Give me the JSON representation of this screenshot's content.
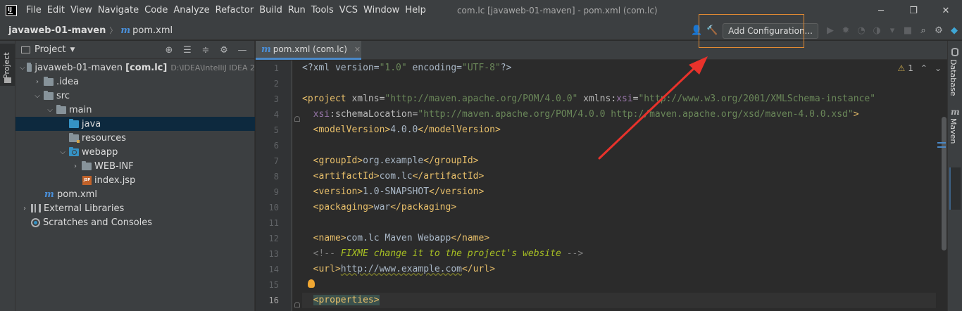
{
  "menu": {
    "items": [
      "File",
      "Edit",
      "View",
      "Navigate",
      "Code",
      "Analyze",
      "Refactor",
      "Build",
      "Run",
      "Tools",
      "VCS",
      "Window",
      "Help"
    ],
    "window_title": "com.lc [javaweb-01-maven] - pom.xml (com.lc)"
  },
  "window_controls": {
    "minimize": "─",
    "restore": "❐",
    "close": "✕"
  },
  "navbar": {
    "project": "javaweb-01-maven",
    "file": "pom.xml",
    "add_configuration": "Add Configuration..."
  },
  "project_panel": {
    "title": "Project",
    "tree": {
      "root_name": "javaweb-01-maven",
      "root_module": "[com.lc]",
      "root_path": "D:\\IDEA\\IntelliJ IDEA 2",
      "idea": ".idea",
      "src": "src",
      "main": "main",
      "java": "java",
      "resources": "resources",
      "webapp": "webapp",
      "webinf": "WEB-INF",
      "indexjsp": "index.jsp",
      "pom": "pom.xml",
      "external_libraries": "External Libraries",
      "scratches": "Scratches and Consoles"
    }
  },
  "left_stripe": {
    "project_tab": "Project"
  },
  "right_stripe": {
    "database": "Database",
    "maven": "Maven"
  },
  "editor": {
    "tab_label": "pom.xml (com.lc)",
    "warning_count": "1",
    "line_numbers": [
      "1",
      "2",
      "3",
      "4",
      "5",
      "6",
      "7",
      "8",
      "9",
      "10",
      "11",
      "12",
      "13",
      "14",
      "15",
      "16"
    ],
    "current_line": "16",
    "code": {
      "l1_a": "<?xml version=",
      "l1_b": "\"1.0\"",
      "l1_c": " encoding=",
      "l1_d": "\"UTF-8\"",
      "l1_e": "?>",
      "l3_tag": "<project",
      "l3_attr1": " xmlns=",
      "l3_val1": "\"http://maven.apache.org/POM/4.0.0\"",
      "l3_attr2a": " xmlns:",
      "l3_attr2b": "xsi",
      "l3_attr2c": "=",
      "l3_val2": "\"http://www.w3.org/2001/XMLSchema-instance\"",
      "l4_ns": "xsi",
      "l4_attr": ":schemaLocation=",
      "l4_val": "\"http://maven.apache.org/POM/4.0.0 http://maven.apache.org/xsd/maven-4.0.0.xsd\"",
      "l4_end": ">",
      "l5_open": "<modelVersion>",
      "l5_text": "4.0.0",
      "l5_close": "</modelVersion>",
      "l7_open": "<groupId>",
      "l7_text": "org.example",
      "l7_close": "</groupId>",
      "l8_open": "<artifactId>",
      "l8_text": "com.lc",
      "l8_close": "</artifactId>",
      "l9_open": "<version>",
      "l9_text": "1.0-SNAPSHOT",
      "l9_close": "</version>",
      "l10_open": "<packaging>",
      "l10_text": "war",
      "l10_close": "</packaging>",
      "l12_open": "<name>",
      "l12_text": "com.lc Maven Webapp",
      "l12_close": "</name>",
      "l13_start": "<!-- ",
      "l13_todo": "FIXME change it to the project's website",
      "l13_end": " -->",
      "l14_open": "<url>",
      "l14_text": "http://www.example.com",
      "l14_close": "</url>",
      "l16_open": "<properties>"
    }
  },
  "colors": {
    "accent": "#4a88c7",
    "highlight_box": "#e28a33",
    "annotation_arrow": "#e8322b"
  }
}
